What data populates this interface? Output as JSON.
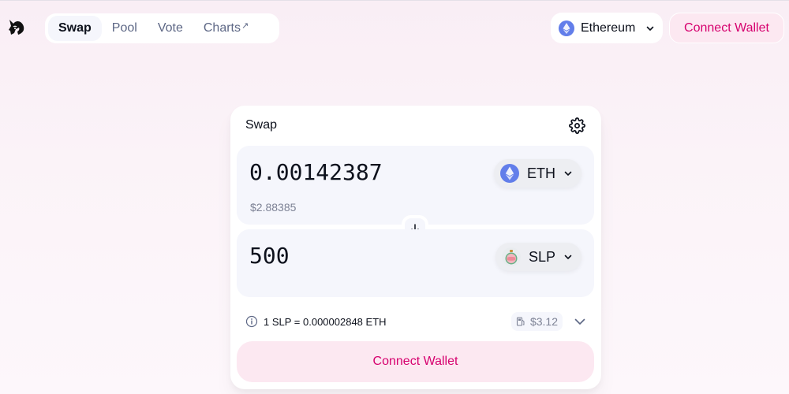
{
  "header": {
    "nav": [
      {
        "label": "Swap",
        "active": true
      },
      {
        "label": "Pool",
        "active": false
      },
      {
        "label": "Vote",
        "active": false
      },
      {
        "label": "Charts",
        "external_marker": "↗",
        "active": false
      }
    ],
    "network": {
      "label": "Ethereum",
      "icon": "ethereum-icon"
    },
    "connect_wallet_label": "Connect Wallet"
  },
  "swap": {
    "title": "Swap",
    "input": {
      "amount": "0.00142387",
      "usd_value": "$2.88385",
      "token": "ETH"
    },
    "output": {
      "amount": "500",
      "token": "SLP"
    },
    "rate_text": "1 SLP = 0.000002848 ETH",
    "gas_fee": "$3.12",
    "connect_wallet_label": "Connect Wallet"
  },
  "colors": {
    "accent_pink": "#d6006e",
    "button_pink_bg": "#fce8f1",
    "panel_bg": "#f5f6fc",
    "eth_blue": "#627eea"
  }
}
